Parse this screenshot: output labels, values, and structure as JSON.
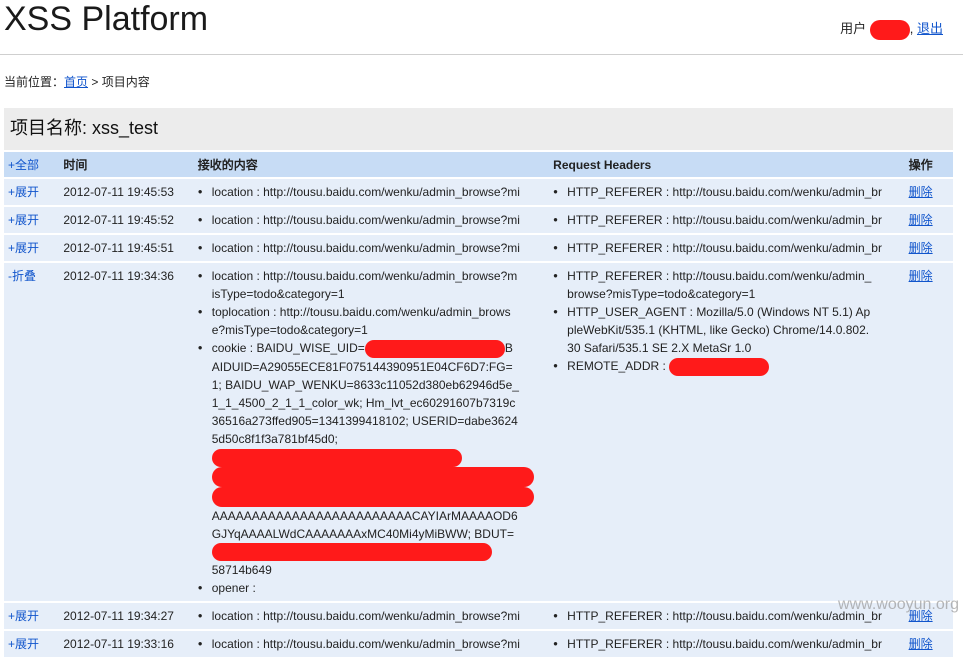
{
  "header": {
    "logo": "XSS Platform",
    "user_label": "用户",
    "comma": ",",
    "logout": "退出"
  },
  "breadcrumb": {
    "prefix": "当前位置：",
    "home": "首页",
    "sep": " > ",
    "current": "项目内容"
  },
  "project": {
    "title": "项目名称: xss_test"
  },
  "table": {
    "columns": {
      "control": "+全部",
      "time": "时间",
      "content": "接收的内容",
      "headers": "Request Headers",
      "op": "操作"
    },
    "rows": [
      {
        "control": "+展开",
        "time": "2012-07-11 19:45:53",
        "content": [
          "location : http://tousu.baidu.com/wenku/admin_browse?mi"
        ],
        "headers": [
          "HTTP_REFERER : http://tousu.baidu.com/wenku/admin_br"
        ],
        "op": "删除"
      },
      {
        "control": "+展开",
        "time": "2012-07-11 19:45:52",
        "content": [
          "location : http://tousu.baidu.com/wenku/admin_browse?mi"
        ],
        "headers": [
          "HTTP_REFERER : http://tousu.baidu.com/wenku/admin_br"
        ],
        "op": "删除"
      },
      {
        "control": "+展开",
        "time": "2012-07-11 19:45:51",
        "content": [
          "location : http://tousu.baidu.com/wenku/admin_browse?mi"
        ],
        "headers": [
          "HTTP_REFERER : http://tousu.baidu.com/wenku/admin_br"
        ],
        "op": "删除"
      },
      {
        "control": "-折叠",
        "time": "2012-07-11 19:34:36",
        "content": [
          "location : http://tousu.baidu.com/wenku/admin_browse?misType=todo&category=1",
          "toplocation : http://tousu.baidu.com/wenku/admin_browse?misType=todo&category=1",
          "cookie : BAIDU_WISE_UID=",
          "opener :"
        ],
        "cookie_tail": "BAIDUID=A29055ECE81F075144390951E04CF6D7:FG=1; BAIDU_WAP_WENKU=8633c11052d380eb62946d5e_1_1_4500_2_1_1_color_wk; Hm_lvt_ec60291607b7319c36516a273ffed905=1341399418102; USERID=dabe36245d50c8f1f3a781bf45d0;",
        "cookie_mid": "AAAAAAAAAAAAAAAAAAAAAAAAACAYIArMAAAAOD6GJYqAAAALWdCAAAAAAAxMC40Mi4yMi",
        "cookie_end": "BWW; BDUT=",
        "cookie_last": "58714b649",
        "headers": [
          "HTTP_REFERER : http://tousu.baidu.com/wenku/admin_browse?misType=todo&category=1",
          "HTTP_USER_AGENT : Mozilla/5.0 (Windows NT 5.1) AppleWebKit/535.1 (KHTML, like Gecko) Chrome/14.0.802.30 Safari/535.1 SE 2.X MetaSr 1.0",
          "REMOTE_ADDR :"
        ],
        "op": "删除"
      },
      {
        "control": "+展开",
        "time": "2012-07-11 19:34:27",
        "content": [
          "location : http://tousu.baidu.com/wenku/admin_browse?mi"
        ],
        "headers": [
          "HTTP_REFERER : http://tousu.baidu.com/wenku/admin_br"
        ],
        "op": "删除"
      },
      {
        "control": "+展开",
        "time": "2012-07-11 19:33:16",
        "content": [
          "location : http://tousu.baidu.com/wenku/admin_browse?mi"
        ],
        "headers": [
          "HTTP_REFERER : http://tousu.baidu.com/wenku/admin_br"
        ],
        "op": "删除"
      }
    ]
  },
  "watermark": "www.wooyun.org",
  "colors": {
    "redaction": "#ff1a1a",
    "header_row": "#c7dcf5",
    "row_bg": "#e6eef9",
    "link": "#1155cc"
  }
}
